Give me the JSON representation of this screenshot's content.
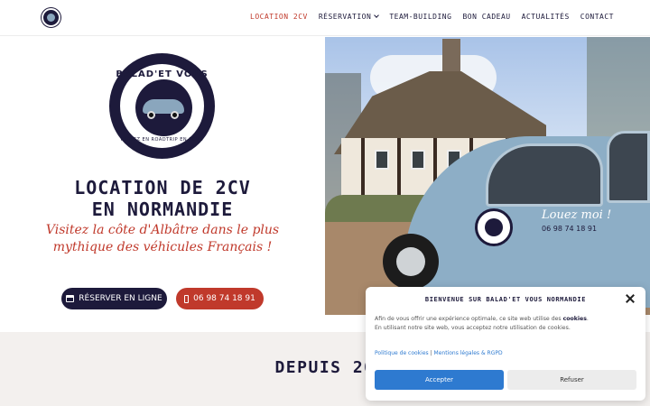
{
  "colors": {
    "navy": "#1d1a3b",
    "red": "#c0392b",
    "blue": "#2e7ad0",
    "band": "#f3f0ee"
  },
  "header": {
    "logo_icon": "brand-logo-icon",
    "nav": [
      {
        "label": "LOCATION 2CV",
        "active": true
      },
      {
        "label": "RÉSERVATION",
        "has_dropdown": true
      },
      {
        "label": "TEAM-BUILDING"
      },
      {
        "label": "BON CADEAU"
      },
      {
        "label": "ACTUALITÉS"
      },
      {
        "label": "CONTACT"
      }
    ]
  },
  "hero": {
    "badge": {
      "top_text": "BALAD'ET VOUS",
      "bottom_text": "PARTEZ EN ROADTRIP EN 2CV !"
    },
    "title_line1": "LOCATION DE 2CV",
    "title_line2": "EN NORMANDIE",
    "subtitle": "Visitez la côte d'Albâtre dans le plus mythique des véhicules Français !",
    "reserve_button": "RÉSERVER EN LIGNE",
    "phone_button": "06 98 74 18 91",
    "image": {
      "car_script": "Louez moi !",
      "car_phone": "06 98 74 18 91"
    }
  },
  "section": {
    "heading": "DEPUIS 20"
  },
  "cookie": {
    "title": "BIENVENUE SUR BALAD'ET VOUS NORMANDIE",
    "body_1": "Afin de vous offrir une expérience optimale, ce site web utilise des ",
    "body_bold": "cookies",
    "body_2": ". En utilisant notre site web, vous acceptez notre utilisation de cookies.",
    "link_policy": "Politique de cookies",
    "separator": "|",
    "link_legal": "Mentions légales & RGPD",
    "accept": "Accepter",
    "refuse": "Refuser"
  }
}
